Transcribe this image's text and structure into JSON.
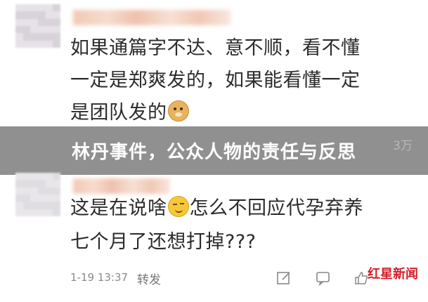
{
  "comments": [
    {
      "lines": [
        "如果通篇字不达、意不顺，看不懂",
        "一定是郑爽发的，如果能看懂一定",
        "是团队发的"
      ],
      "emoji": "doge-icon"
    },
    {
      "lines": [
        "这是在说啥",
        "怎么不回应代孕弃养",
        "七个月了还想打掉???"
      ],
      "emoji": "smirk-icon"
    }
  ],
  "banner": {
    "title": "林丹事件，公众人物的责任与反思",
    "ghost_count": "3万"
  },
  "footer": {
    "time": "1-19 13:37",
    "share": "转发"
  },
  "watermark": {
    "text": "红星新闻"
  },
  "colors": {
    "banner": "#787878",
    "watermark": "#d4212a"
  }
}
